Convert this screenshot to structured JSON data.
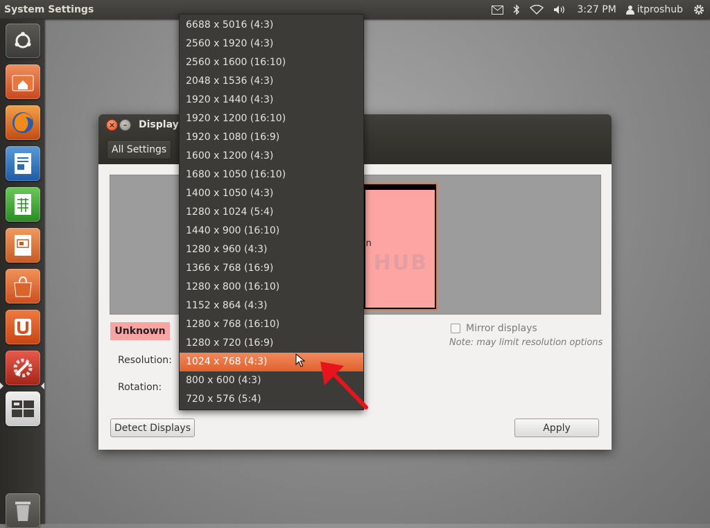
{
  "top_panel": {
    "app_title": "System Settings",
    "indicators": [
      {
        "icon": "mail-icon"
      },
      {
        "icon": "bluetooth-icon"
      },
      {
        "icon": "wifi-icon"
      },
      {
        "icon": "volume-icon"
      }
    ],
    "clock": "3:27 PM",
    "user": "itproshub",
    "session_icon": "gear-icon"
  },
  "launcher": {
    "items": [
      {
        "name": "dash-home",
        "icon": "ubuntu-logo-icon"
      },
      {
        "name": "home-folder",
        "icon": "folder-icon"
      },
      {
        "name": "firefox",
        "icon": "firefox-icon"
      },
      {
        "name": "libreoffice-writer",
        "icon": "writer-icon"
      },
      {
        "name": "libreoffice-calc",
        "icon": "calc-icon"
      },
      {
        "name": "libreoffice-impress",
        "icon": "impress-icon"
      },
      {
        "name": "software-center",
        "icon": "shopping-bag-icon"
      },
      {
        "name": "ubuntu-one",
        "icon": "ubuntu-one-icon"
      },
      {
        "name": "system-settings",
        "icon": "settings-wrench-icon"
      },
      {
        "name": "workspace-switcher",
        "icon": "workspaces-icon"
      },
      {
        "name": "trash",
        "icon": "trash-icon"
      }
    ]
  },
  "window": {
    "title": "Displays",
    "all_settings_label": "All Settings",
    "monitor_label": "wn",
    "display_name": "Unknown",
    "mirror_label": "Mirror displays",
    "mirror_checked": false,
    "mirror_note": "Note: may limit resolution options",
    "resolution_label": "Resolution:",
    "rotation_label": "Rotation:",
    "detect_label": "Detect Displays",
    "apply_label": "Apply"
  },
  "resolution_dropdown": {
    "selected_index": 18,
    "options": [
      "6688 x 5016 (4:3)",
      "2560 x 1920 (4:3)",
      "2560 x 1600 (16:10)",
      "2048 x 1536 (4:3)",
      "1920 x 1440 (4:3)",
      "1920 x 1200 (16:10)",
      "1920 x 1080 (16:9)",
      "1600 x 1200 (4:3)",
      "1680 x 1050 (16:10)",
      "1400 x 1050 (4:3)",
      "1280 x 1024 (5:4)",
      "1440 x 900 (16:10)",
      "1280 x 960 (4:3)",
      "1366 x 768 (16:9)",
      "1280 x 800 (16:10)",
      "1152 x 864 (4:3)",
      "1280 x 768 (16:10)",
      "1280 x 720 (16:9)",
      "1024 x 768 (4:3)",
      "800 x 600 (4:3)",
      "720 x 576 (5:4)"
    ]
  },
  "watermark": "IT Pros HUB",
  "colors": {
    "accent": "#e0612e",
    "panel": "#3c3b37",
    "display_badge": "#f9a4a2",
    "annotation_arrow": "#e8141b"
  }
}
